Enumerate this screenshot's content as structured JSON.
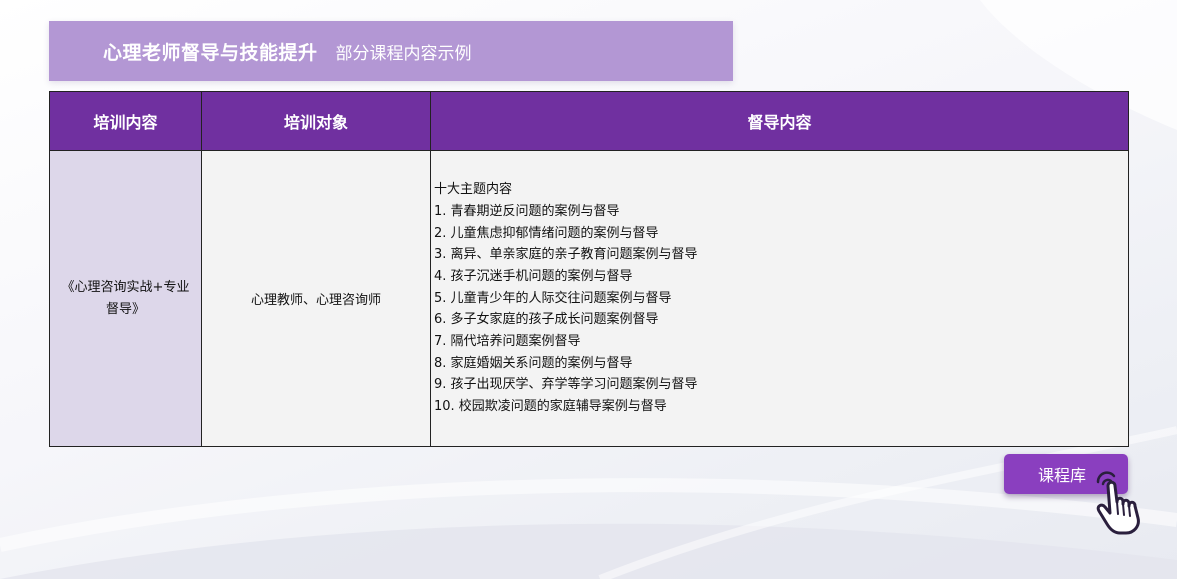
{
  "header": {
    "title": "心理老师督导与技能提升",
    "subtitle": "部分课程内容示例"
  },
  "table": {
    "columns": [
      "培训内容",
      "培训对象",
      "督导内容"
    ],
    "row": {
      "training": "《心理咨询实战+专业督导》",
      "target": "心理教师、心理咨询师",
      "content_lines": [
        "十大主题内容",
        "1. 青春期逆反问题的案例与督导",
        "2. 儿童焦虑抑郁情绪问题的案例与督导",
        "3. 离异、单亲家庭的亲子教育问题案例与督导",
        "4. 孩子沉迷手机问题的案例与督导",
        "5. 儿童青少年的人际交往问题案例与督导",
        "6. 多子女家庭的孩子成长问题案例督导",
        "7. 隔代培养问题案例督导",
        "8. 家庭婚姻关系问题的案例与督导",
        "9. 孩子出现厌学、弃学等学习问题案例与督导",
        "10. 校园欺凌问题的家庭辅导案例与督导"
      ]
    }
  },
  "button": {
    "label": "课程库"
  },
  "icons": {
    "cursor": "pointing-hand-icon"
  },
  "colors": {
    "header_bg": "#b397d4",
    "table_header_bg": "#7030a0",
    "training_cell_bg": "#ddd7ea",
    "button_bg": "#8a3fbf"
  }
}
